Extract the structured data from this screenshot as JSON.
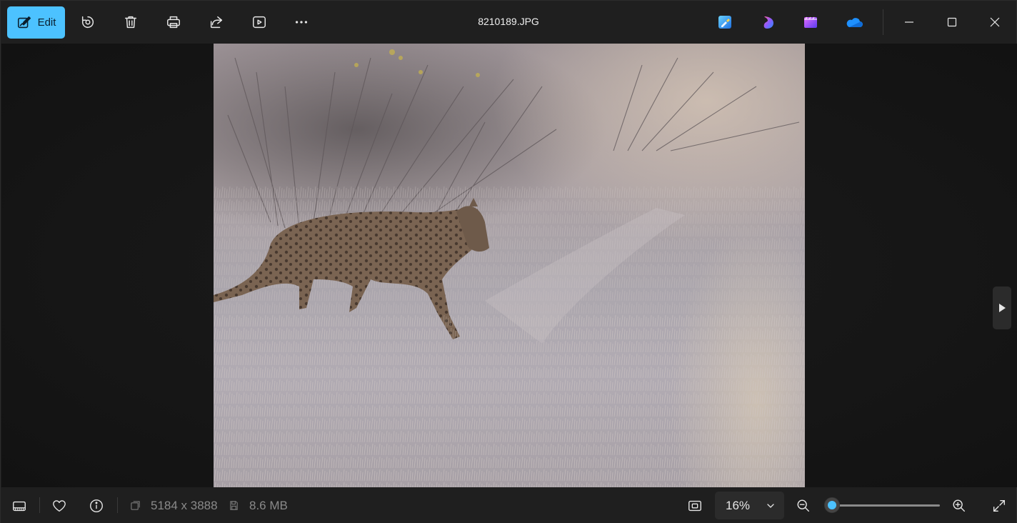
{
  "window": {
    "title": "8210189.JPG"
  },
  "toolbar": {
    "edit_label": "Edit",
    "icons": [
      "edit-icon",
      "rotate-icon",
      "delete-icon",
      "print-icon",
      "share-icon",
      "slideshow-icon",
      "more-icon"
    ],
    "accent_color": "#4cc2ff"
  },
  "apps": [
    "paint-app-icon",
    "copilot-app-icon",
    "clipchamp-app-icon",
    "onedrive-app-icon"
  ],
  "window_controls": [
    "minimize-icon",
    "maximize-icon",
    "close-icon"
  ],
  "statusbar": {
    "dimensions": "5184 x 3888",
    "file_size": "8.6 MB",
    "zoom_value": "16%",
    "zoom_level": 0.0
  },
  "photo": {
    "subject": "leopard-in-grass"
  }
}
